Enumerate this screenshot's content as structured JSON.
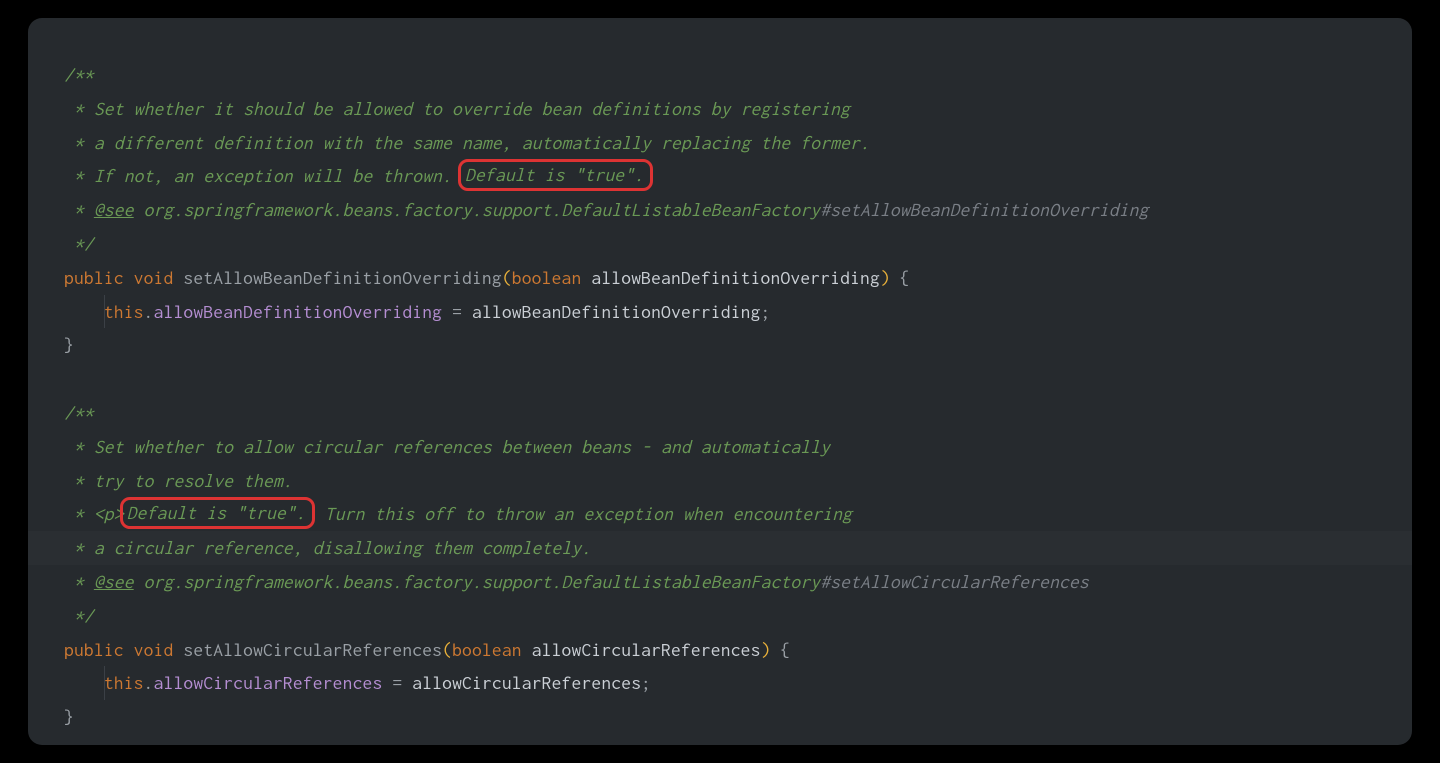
{
  "code": {
    "method1": {
      "doc": {
        "open": "/**",
        "line1": " * Set whether it should be allowed to override bean definitions by registering",
        "line2": " * a different definition with the same name, automatically replacing the former.",
        "line3_prefix": " * If not, an exception will be thrown. ",
        "highlight": "Default is \"true\".",
        "see_prefix": " * ",
        "see_tag": "@see",
        "see_pkg": " org.springframework.beans.factory.support.DefaultListableBeanFactory",
        "see_hash": "#setAllowBeanDefinitionOverriding",
        "close": " */"
      },
      "sig": {
        "public": "public",
        "void": "void",
        "name": "setAllowBeanDefinitionOverriding",
        "lparen": "(",
        "ptype": "boolean",
        "pname": "allowBeanDefinitionOverriding",
        "rparen": ")",
        "obrace": "{"
      },
      "body": {
        "indent": "    ",
        "this": "this",
        "dot": ".",
        "field": "allowBeanDefinitionOverriding",
        "eq": " = ",
        "rhs": "allowBeanDefinitionOverriding",
        "semi": ";"
      },
      "cbrace": "}"
    },
    "blank": "",
    "method2": {
      "doc": {
        "open": "/**",
        "line1": " * Set whether to allow circular references between beans - and automatically",
        "line2": " * try to resolve them.",
        "line3_prefix": " * <p>",
        "highlight": "Default is \"true\".",
        "line3_suffix": " Turn this off to throw an exception when encountering",
        "line4": " * a circular reference, disallowing them completely.",
        "see_prefix": " * ",
        "see_tag": "@see",
        "see_pkg": " org.springframework.beans.factory.support.DefaultListableBeanFactory",
        "see_hash": "#setAllowCircularReferences",
        "close": " */"
      },
      "sig": {
        "public": "public",
        "void": "void",
        "name": "setAllowCircularReferences",
        "lparen": "(",
        "ptype": "boolean",
        "pname": "allowCircularReferences",
        "rparen": ")",
        "obrace": "{"
      },
      "body": {
        "indent": "    ",
        "this": "this",
        "dot": ".",
        "field": "allowCircularReferences",
        "eq": " = ",
        "rhs": "allowCircularReferences",
        "semi": ";"
      },
      "cbrace": "}"
    }
  }
}
